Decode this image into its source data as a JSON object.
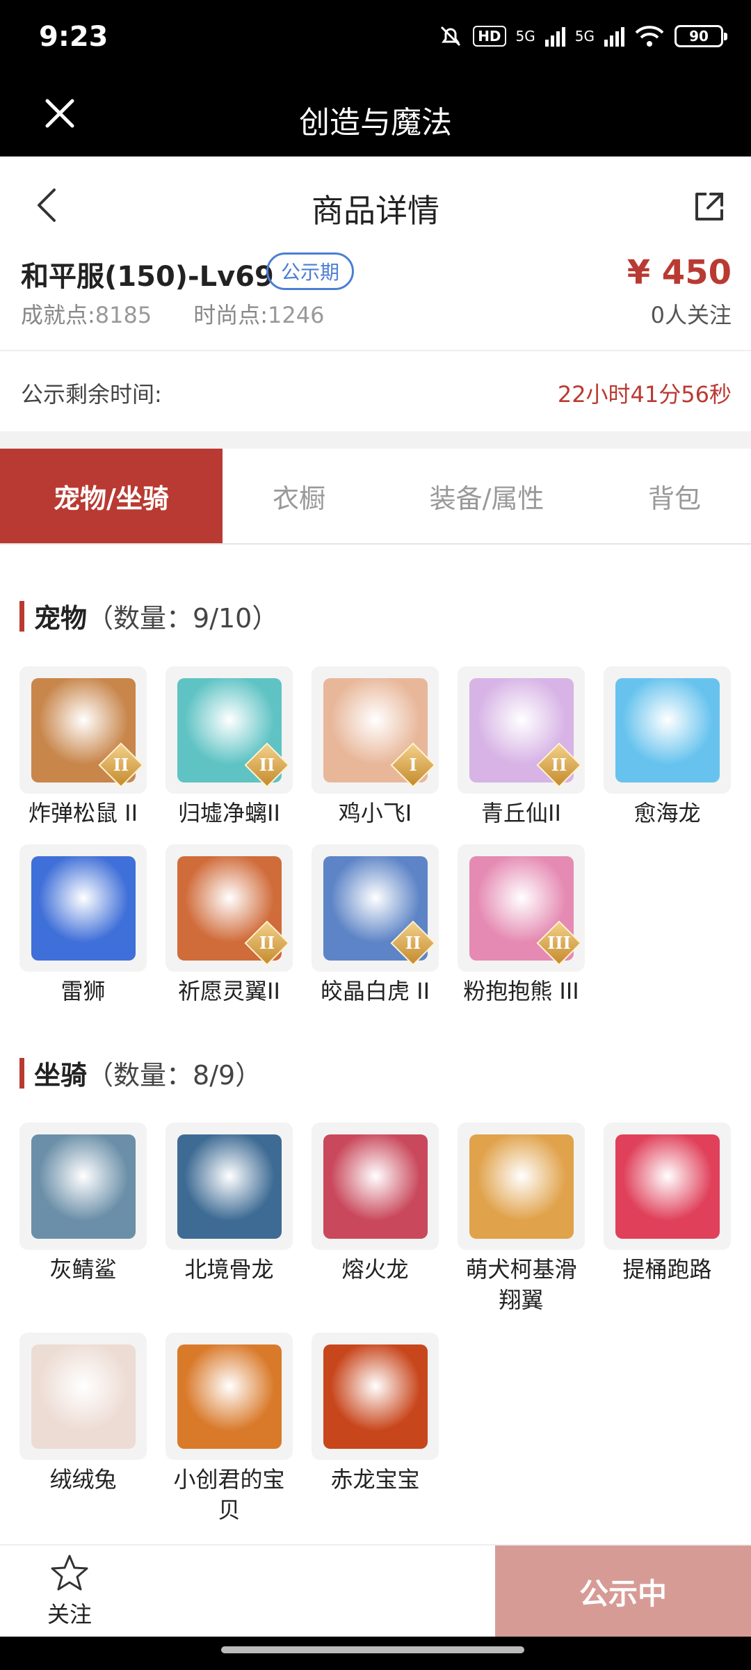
{
  "status_bar": {
    "time": "9:23",
    "hd": "HD",
    "net1": "5G",
    "net2": "5G",
    "battery": "90"
  },
  "title_bar": {
    "title": "创造与魔法",
    "close_icon": "close-icon"
  },
  "nav_bar": {
    "title": "商品详情",
    "back_icon": "chevron-left-icon",
    "share_icon": "share-icon"
  },
  "product": {
    "name": "和平服(150)-Lv69",
    "badge": "公示期",
    "achievement_label": "成就点:",
    "achievement_value": "8185",
    "fashion_label": "时尚点:",
    "fashion_value": "1246",
    "price": "¥ 450",
    "followers": "0人关注"
  },
  "countdown": {
    "label": "公示剩余时间:",
    "value": "22小时41分56秒"
  },
  "tabs": [
    {
      "label": "宠物/坐骑",
      "active": true
    },
    {
      "label": "衣橱",
      "active": false
    },
    {
      "label": "装备/属性",
      "active": false
    },
    {
      "label": "背包",
      "active": false
    }
  ],
  "pets": {
    "title": "宠物",
    "count": "（数量：9/10）",
    "items": [
      {
        "name": "炸弹松鼠 II",
        "rank": "II",
        "color": "#c8864b"
      },
      {
        "name": "归墟净螭II",
        "rank": "II",
        "color": "#5fc3c4"
      },
      {
        "name": "鸡小飞I",
        "rank": "I",
        "color": "#e8b79a"
      },
      {
        "name": "青丘仙II",
        "rank": "II",
        "color": "#d7b3e6"
      },
      {
        "name": "愈海龙",
        "rank": "",
        "color": "#67c3ee"
      },
      {
        "name": "雷狮",
        "rank": "",
        "color": "#3f6fd8"
      },
      {
        "name": "祈愿灵翼II",
        "rank": "II",
        "color": "#d06b3a"
      },
      {
        "name": "皎晶白虎 II",
        "rank": "II",
        "color": "#5d84c6"
      },
      {
        "name": "粉抱抱熊 III",
        "rank": "III",
        "color": "#e58ab2"
      }
    ]
  },
  "mounts": {
    "title": "坐骑",
    "count": "（数量：8/9）",
    "items": [
      {
        "name": "灰鲭鲨",
        "color": "#6b8fa8"
      },
      {
        "name": "北境骨龙",
        "color": "#3e6b94"
      },
      {
        "name": "熔火龙",
        "color": "#c9485b"
      },
      {
        "name": "萌犬柯基滑翔翼",
        "color": "#e0a24a"
      },
      {
        "name": "提桶跑路",
        "color": "#e0405a"
      },
      {
        "name": "绒绒兔",
        "color": "#eddcd4"
      },
      {
        "name": "小创君的宝贝",
        "color": "#d97a2b"
      },
      {
        "name": "赤龙宝宝",
        "color": "#c8461c"
      }
    ]
  },
  "bottom_bar": {
    "follow_label": "关注",
    "action_label": "公示中"
  }
}
